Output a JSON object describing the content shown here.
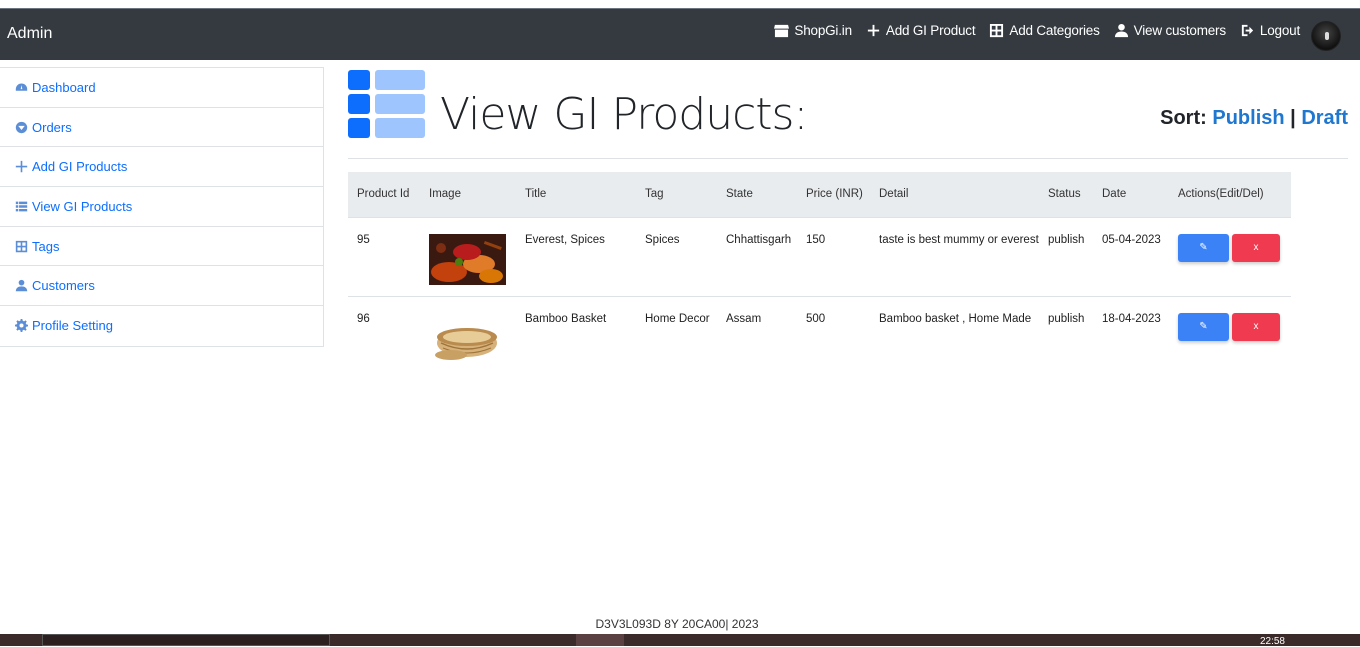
{
  "navbar": {
    "brand": "Admin",
    "links": [
      {
        "label": "ShopGi.in",
        "icon": "store-icon"
      },
      {
        "label": "Add GI Product",
        "icon": "plus-icon"
      },
      {
        "label": "Add Categories",
        "icon": "grid-icon"
      },
      {
        "label": "View customers",
        "icon": "user-icon"
      },
      {
        "label": "Logout",
        "icon": "logout-icon"
      }
    ]
  },
  "sidebar": {
    "items": [
      {
        "label": "Dashboard",
        "icon": "speedometer-icon"
      },
      {
        "label": "Orders",
        "icon": "chevron-circle-down-icon"
      },
      {
        "label": "Add GI Products",
        "icon": "plus-icon"
      },
      {
        "label": "View GI Products",
        "icon": "list-icon"
      },
      {
        "label": "Tags",
        "icon": "grid-icon"
      },
      {
        "label": "Customers",
        "icon": "user-icon"
      },
      {
        "label": "Profile Setting",
        "icon": "gear-icon"
      }
    ]
  },
  "main": {
    "title": "View GI Products:",
    "sort_label": "Sort:",
    "sort_publish": "Publish",
    "sort_separator": "|",
    "sort_draft": "Draft"
  },
  "table": {
    "headers": [
      "Product Id",
      "Image",
      "Title",
      "Tag",
      "State",
      "Price (INR)",
      "Detail",
      "Status",
      "Date",
      "Actions(Edit/Del)"
    ],
    "rows": [
      {
        "id": "95",
        "image": "spices-image",
        "title": "Everest, Spices",
        "tag": "Spices",
        "state": "Chhattisgarh",
        "price": "150",
        "detail": "taste is best mummy or everest",
        "status": "publish",
        "date": "05-04-2023",
        "edit": "✎",
        "del": "x"
      },
      {
        "id": "96",
        "image": "basket-image",
        "title": "Bamboo Basket",
        "tag": "Home Decor",
        "state": "Assam",
        "price": "500",
        "detail": "Bamboo basket , Home Made",
        "status": "publish",
        "date": "18-04-2023",
        "edit": "✎",
        "del": "x"
      }
    ]
  },
  "footer": {
    "text": "D3V3L093D 8Y 20CA00| 2023"
  },
  "taskbar": {
    "clock": "22:58"
  },
  "colors": {
    "navbar": "#343a40",
    "link": "#0d6efd",
    "edit": "#3b82f6",
    "delete": "#ef3a4f"
  }
}
